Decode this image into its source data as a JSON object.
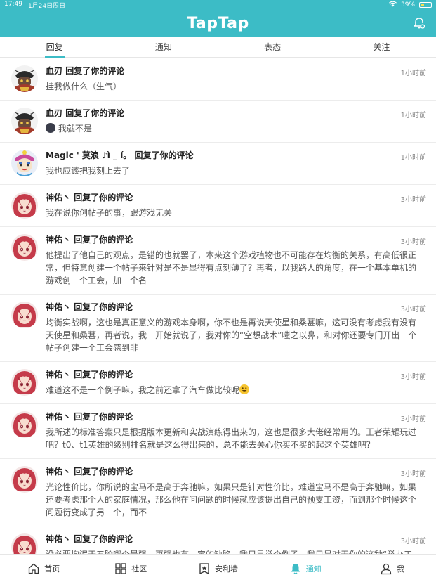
{
  "status": {
    "time": "17:49",
    "date": "1月24日周日",
    "battery": "39%",
    "battery_level": 0.39
  },
  "header": {
    "logo": "TapTap",
    "settings_icon": "gear-bell-icon"
  },
  "tabs": [
    {
      "label": "回复",
      "active": true
    },
    {
      "label": "通知",
      "active": false
    },
    {
      "label": "表态",
      "active": false
    },
    {
      "label": "关注",
      "active": false
    }
  ],
  "items": [
    {
      "user": "血刃",
      "action": "回复了你的评论",
      "time": "1小时前",
      "body": "挂我做什么（生气）",
      "avatar": "warrior"
    },
    {
      "user": "血刃",
      "action": "回复了你的评论",
      "time": "1小时前",
      "body": "我就不是",
      "avatar": "warrior",
      "emoji": "dark"
    },
    {
      "user": "Magic ' 莫浪 ♪ì _ í。",
      "action": "回复了你的评论",
      "time": "1小时前",
      "body": "我也应该把我刻上去了",
      "avatar": "clown"
    },
    {
      "user": "神佑丶",
      "action": "回复了你的评论",
      "time": "3小时前",
      "body": "我在说你创帖子的事，跟游戏无关",
      "avatar": "anime"
    },
    {
      "user": "神佑丶",
      "action": "回复了你的评论",
      "time": "3小时前",
      "body": "他提出了他自己的观点，是错的也就罢了，本来这个游戏植物也不可能存在均衡的关系，有高低很正常，但特意创建一个帖子来针对是不是显得有点刻薄了？再者，以我路人的角度，在一个基本单机的游戏创一个工会，加一个名",
      "avatar": "anime"
    },
    {
      "user": "神佑丶",
      "action": "回复了你的评论",
      "time": "3小时前",
      "body": "均衡实战啊，这也是真正意义的游戏本身啊，你不也是再说天使星和桑葚嘛，这可没有考虑我有没有天使星和桑葚，再者说，我一开始就说了，我对你的“空想战术”嗤之以鼻，和对你还要专门开出一个帖子创建一个工会感到非",
      "avatar": "anime"
    },
    {
      "user": "神佑丶",
      "action": "回复了你的评论",
      "time": "3小时前",
      "body": "难道这不是一个例子嘛，我之前还拿了汽车做比较呢",
      "avatar": "anime",
      "emoji": "smile"
    },
    {
      "user": "神佑丶",
      "action": "回复了你的评论",
      "time": "3小时前",
      "body": "我所述的标准答案只是根据版本更新和实战演练得出来的，这也是很多大佬经常用的。王者荣耀玩过吧？t0、t1英雄的级别排名就是这么得出来的，总不能去关心你买不买的起这个英雄吧？",
      "avatar": "anime"
    },
    {
      "user": "神佑丶",
      "action": "回复了你的评论",
      "time": "3小时前",
      "body": "光论性价比，你所说的宝马不是高于奔驰嘛，如果只是针对性价比，难道宝马不是高于奔驰嘛，如果还要考虑那个人的家庭情况，那么他在问问题的时候就应该提出自己的预支工资，而到那个时候这个问题衍变成了另一个，而不",
      "avatar": "anime"
    },
    {
      "user": "神佑丶",
      "action": "回复了你的评论",
      "time": "3小时前",
      "body": "没必要拘泥于五阶哪个最强，再强也有一定的缺陷，我只是举个例子，我只是对于你的这种“举办工会？传播思想”的方式很不赞同，在我看来就是加一个名字前缀提高知名度。本来萌新问什么问题如实答就好了，至于考虑萌新",
      "avatar": "anime"
    }
  ],
  "bottom_nav": [
    {
      "label": "首页",
      "icon": "home-icon",
      "active": false
    },
    {
      "label": "社区",
      "icon": "grid-icon",
      "active": false
    },
    {
      "label": "安利墙",
      "icon": "star-frame-icon",
      "active": false
    },
    {
      "label": "通知",
      "icon": "bell-icon",
      "active": true
    },
    {
      "label": "我",
      "icon": "user-icon",
      "active": false
    }
  ],
  "colors": {
    "brand": "#3cbcc6",
    "battery_fill": "#f4e04d"
  }
}
